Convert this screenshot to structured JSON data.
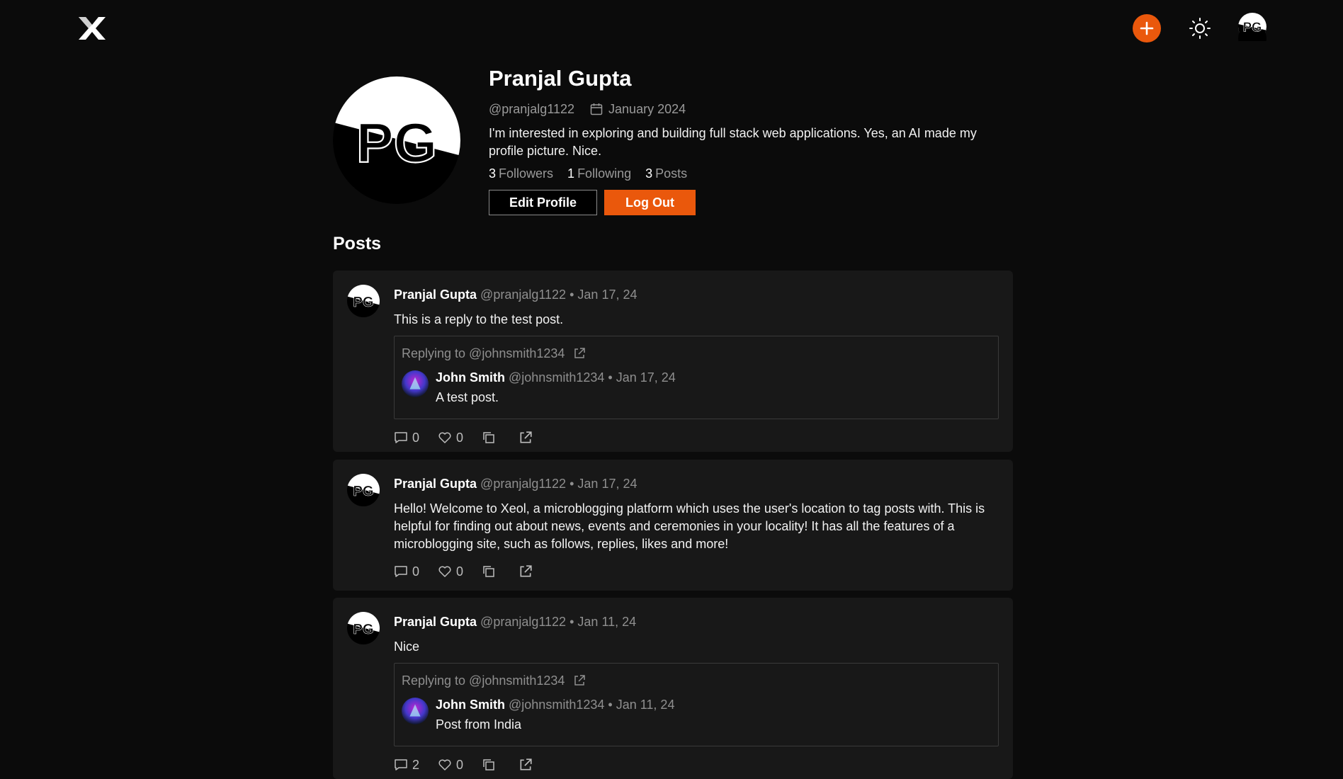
{
  "app": {
    "logo_icon": "x-logo-icon",
    "accent": "#ea580c"
  },
  "topbar": {
    "new_post_icon": "plus-icon",
    "theme_icon": "sun-icon",
    "avatar_initials": "PG"
  },
  "profile": {
    "avatar_initials": "PG",
    "name": "Pranjal Gupta",
    "handle": "@pranjalg1122",
    "joined": "January 2024",
    "bio": "I'm interested in exploring and building full stack web applications. Yes, an AI made my profile picture. Nice.",
    "stats": {
      "followers_count": "3",
      "followers_label": "Followers",
      "following_count": "1",
      "following_label": "Following",
      "posts_count": "3",
      "posts_label": "Posts"
    },
    "edit_label": "Edit Profile",
    "logout_label": "Log Out"
  },
  "posts_heading": "Posts",
  "posts": [
    {
      "author": "Pranjal Gupta",
      "handle": "@pranjalg1122",
      "dot": "•",
      "date": "Jan 17, 24",
      "text": "This is a reply to the test post.",
      "quote": {
        "replying_to": "Replying to @johnsmith1234",
        "author": "John Smith",
        "handle": "@johnsmith1234",
        "dot": "•",
        "date": "Jan 17, 24",
        "text": "A test post."
      },
      "replies": "0",
      "likes": "0"
    },
    {
      "author": "Pranjal Gupta",
      "handle": "@pranjalg1122",
      "dot": "•",
      "date": "Jan 17, 24",
      "text": "Hello! Welcome to Xeol, a microblogging platform which uses the user's location to tag posts with. This is helpful for finding out about news, events and ceremonies in your locality! It has all the features of a microblogging site, such as follows, replies, likes and more!",
      "replies": "0",
      "likes": "0"
    },
    {
      "author": "Pranjal Gupta",
      "handle": "@pranjalg1122",
      "dot": "•",
      "date": "Jan 11, 24",
      "text": "Nice",
      "quote": {
        "replying_to": "Replying to @johnsmith1234",
        "author": "John Smith",
        "handle": "@johnsmith1234",
        "dot": "•",
        "date": "Jan 11, 24",
        "text": "Post from India"
      },
      "replies": "2",
      "likes": "0"
    }
  ]
}
